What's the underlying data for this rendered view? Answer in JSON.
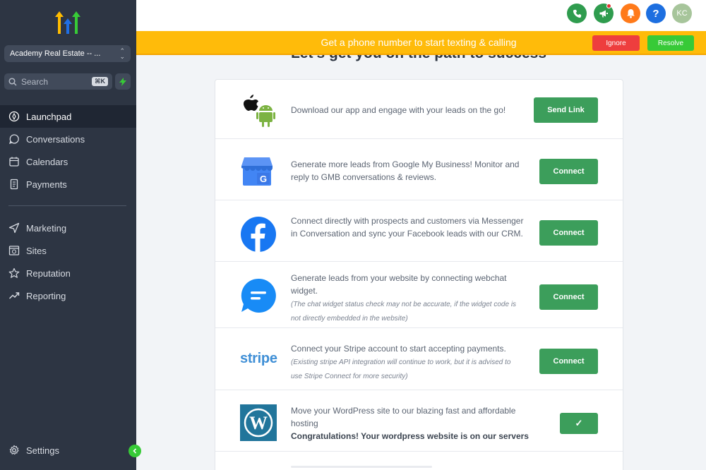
{
  "sidebar": {
    "account": "Academy Real Estate -- ...",
    "search_placeholder": "Search",
    "search_shortcut": "⌘K",
    "items": [
      {
        "label": "Launchpad",
        "icon": "rocket-icon"
      },
      {
        "label": "Conversations",
        "icon": "chat-bubble-icon"
      },
      {
        "label": "Calendars",
        "icon": "calendar-icon"
      },
      {
        "label": "Payments",
        "icon": "receipt-icon"
      },
      {
        "label": "Marketing",
        "icon": "paper-plane-icon"
      },
      {
        "label": "Sites",
        "icon": "globe-window-icon"
      },
      {
        "label": "Reputation",
        "icon": "star-icon"
      },
      {
        "label": "Reporting",
        "icon": "trend-icon"
      }
    ],
    "settings": "Settings"
  },
  "topbar": {
    "avatar_initials": "KC"
  },
  "banner": {
    "text": "Get a phone number to start texting & calling",
    "ignore": "Ignore",
    "resolve": "Resolve"
  },
  "heading": "Let's get you on the path to success",
  "rows": [
    {
      "text": "Download our app and engage with your leads on the go!",
      "button": "Send Link"
    },
    {
      "text": "Generate more leads from Google My Business! Monitor and reply to GMB conversations & reviews.",
      "button": "Connect"
    },
    {
      "text": "Connect directly with prospects and customers via Messenger in Conversation and sync your Facebook leads with our CRM.",
      "button": "Connect"
    },
    {
      "text": "Generate leads from your website by connecting webchat widget.",
      "note": "(The chat widget status check may not be accurate, if the widget code is not directly embedded in the website)",
      "button": "Connect"
    },
    {
      "text": "Connect your Stripe account to start accepting payments.",
      "note": "(Existing stripe API integration will continue to work, but it is advised to use Stripe Connect for more security)",
      "button": "Connect",
      "logo": "stripe"
    },
    {
      "text": "Move your WordPress site to our blazing fast and affordable hosting",
      "strong": "Congratulations! Your wordpress website is on our servers",
      "button": "✓"
    }
  ],
  "colors": {
    "sidebar": "#2d3543",
    "banner": "#ffbb0a",
    "primary_button": "#3c9e5b",
    "ignore": "#ee3e3e",
    "resolve": "#37ca37"
  }
}
